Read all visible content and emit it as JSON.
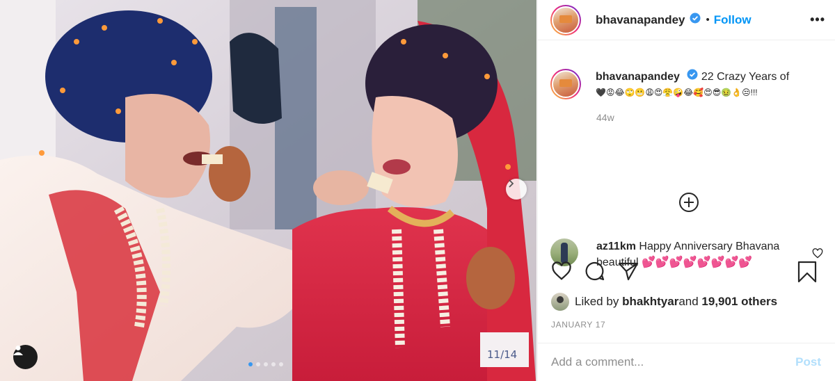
{
  "post": {
    "username": "bhavanapandey",
    "follow_label": "Follow",
    "separator": "•",
    "more_label": "•••",
    "caption_text": " 22 Crazy Years of",
    "caption_emojis": "🖤😡😂🙄😬😩😍😤🤪😂🥰😍😎🤢👌😒!!!",
    "time_ago": "44w",
    "load_more_icon": "plus-circle-icon"
  },
  "comment": {
    "username": "az11km",
    "text": " Happy Anniversary Bhavana beautiful 💕💕💕💕💕💕💕💕"
  },
  "likes": {
    "prefix": "Liked by ",
    "user": "bhakhtyar",
    "middle": " and ",
    "count": "19,901 others"
  },
  "date": "JANUARY 17",
  "composer": {
    "placeholder": "Add a comment...",
    "post_label": "Post"
  },
  "photo": {
    "handwritten_note": "11/14",
    "carousel": {
      "count": 5,
      "active": 0
    }
  },
  "colors": {
    "accent": "#0095f6",
    "post_disabled": "#b2dffc",
    "muted": "#8e8e8e",
    "text": "#262626"
  }
}
